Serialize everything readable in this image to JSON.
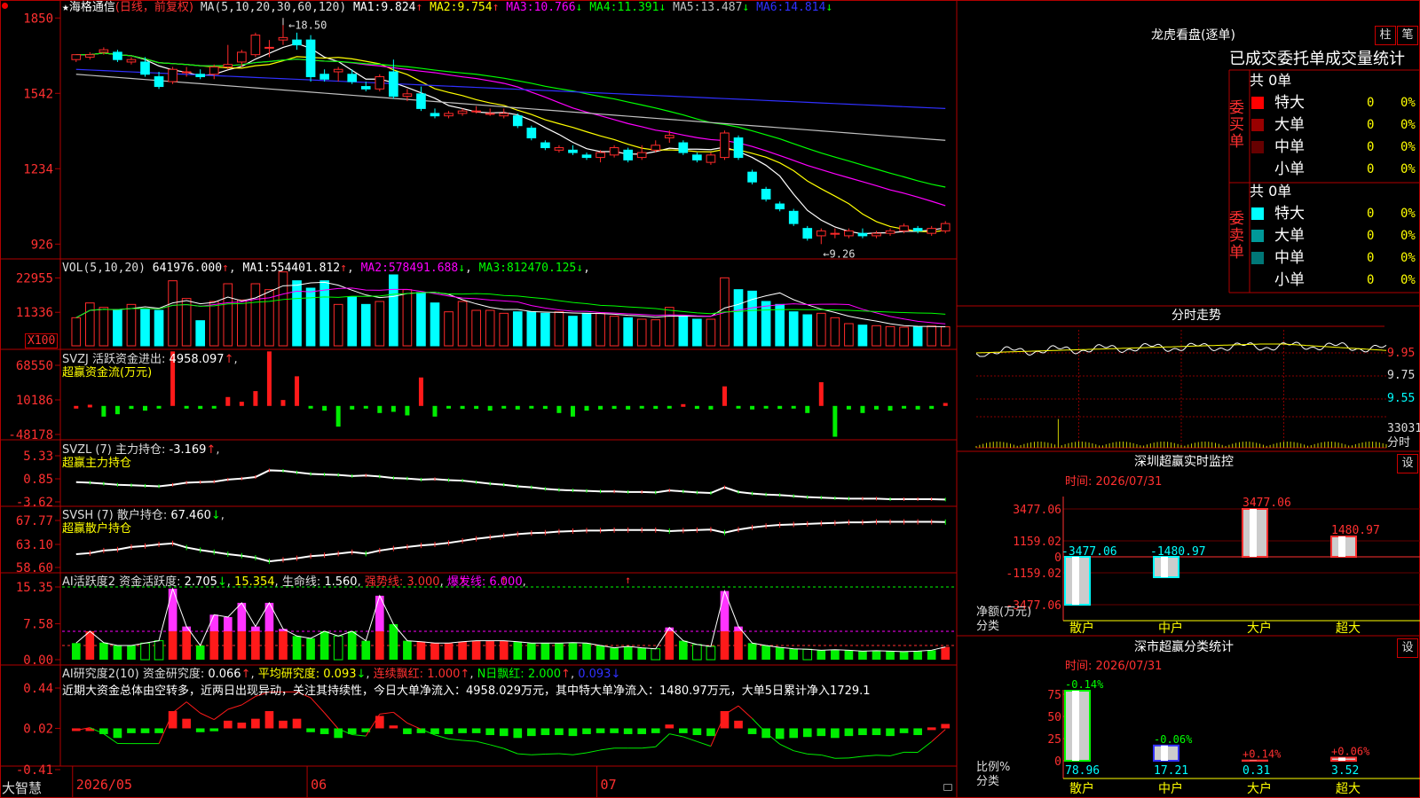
{
  "app": {
    "name": "大智慧",
    "logo_icon": "red-dot-icon"
  },
  "kline": {
    "name": "海格通信",
    "mode": "(日线，前复权)",
    "ma_params": "MA(5,10,20,30,60,120)",
    "ma": [
      {
        "label": "MA1:",
        "value": "9.824",
        "arrow": "↑",
        "color": "#ffffff"
      },
      {
        "label": "MA2:",
        "value": "9.754",
        "arrow": "↑",
        "color": "#ffff00"
      },
      {
        "label": "MA3:",
        "value": "10.766",
        "arrow": "↓",
        "color": "#ff00ff"
      },
      {
        "label": "MA4:",
        "value": "11.391",
        "arrow": "↓",
        "color": "#00ff00"
      },
      {
        "label": "MA5:",
        "value": "13.487",
        "arrow": "↓",
        "color": "#c0c0c0"
      },
      {
        "label": "MA6:",
        "value": "14.814",
        "arrow": "↓",
        "color": "#3030ff"
      }
    ],
    "y_ticks": [
      "1850",
      "1542",
      "1234",
      "926"
    ],
    "high_mark": "18.50",
    "low_mark": "9.26",
    "candles": [
      [
        16.8,
        17.0,
        16.7,
        17.0
      ],
      [
        16.9,
        17.1,
        16.8,
        17.0
      ],
      [
        17.1,
        17.3,
        17.0,
        17.2
      ],
      [
        17.1,
        17.2,
        16.7,
        16.8
      ],
      [
        16.7,
        16.9,
        16.6,
        16.8
      ],
      [
        16.7,
        16.9,
        16.1,
        16.2
      ],
      [
        16.1,
        16.3,
        15.6,
        15.7
      ],
      [
        15.9,
        16.5,
        15.8,
        16.4
      ],
      [
        16.3,
        16.5,
        16.1,
        16.3
      ],
      [
        16.2,
        16.4,
        16.0,
        16.1
      ],
      [
        16.2,
        16.6,
        16.0,
        16.5
      ],
      [
        16.5,
        17.4,
        16.4,
        16.6
      ],
      [
        16.7,
        17.2,
        16.5,
        17.1
      ],
      [
        17.0,
        17.9,
        16.9,
        17.8
      ],
      [
        17.3,
        17.6,
        16.9,
        17.3
      ],
      [
        17.6,
        18.5,
        17.4,
        17.7
      ],
      [
        17.6,
        17.9,
        17.2,
        17.4
      ],
      [
        17.6,
        17.8,
        15.9,
        16.1
      ],
      [
        16.2,
        16.4,
        15.9,
        16.0
      ],
      [
        16.3,
        16.5,
        15.9,
        16.4
      ],
      [
        16.2,
        16.4,
        15.8,
        15.9
      ],
      [
        15.7,
        15.9,
        15.5,
        15.6
      ],
      [
        15.6,
        16.2,
        15.5,
        16.1
      ],
      [
        16.3,
        16.8,
        15.2,
        15.3
      ],
      [
        15.3,
        15.6,
        15.1,
        15.4
      ],
      [
        15.4,
        15.7,
        14.7,
        14.8
      ],
      [
        14.6,
        14.8,
        14.4,
        14.5
      ],
      [
        14.5,
        14.7,
        14.4,
        14.6
      ],
      [
        14.6,
        14.8,
        14.5,
        14.7
      ],
      [
        14.7,
        14.9,
        14.6,
        14.7
      ],
      [
        14.6,
        14.8,
        14.5,
        14.6
      ],
      [
        14.5,
        14.8,
        14.4,
        14.6
      ],
      [
        14.5,
        14.6,
        14.0,
        14.1
      ],
      [
        14.0,
        14.1,
        13.5,
        13.6
      ],
      [
        13.4,
        13.5,
        13.1,
        13.2
      ],
      [
        13.1,
        13.3,
        13.0,
        13.2
      ],
      [
        13.1,
        13.3,
        12.9,
        13.0
      ],
      [
        12.9,
        13.0,
        12.7,
        12.8
      ],
      [
        12.8,
        13.1,
        12.6,
        13.0
      ],
      [
        12.9,
        13.3,
        12.8,
        13.2
      ],
      [
        13.1,
        13.2,
        12.6,
        12.7
      ],
      [
        12.8,
        13.3,
        12.7,
        13.0
      ],
      [
        13.1,
        13.5,
        13.0,
        13.3
      ],
      [
        13.6,
        13.9,
        13.4,
        13.7
      ],
      [
        13.4,
        13.5,
        12.9,
        13.0
      ],
      [
        12.9,
        13.0,
        12.6,
        12.7
      ],
      [
        12.6,
        13.0,
        12.5,
        12.9
      ],
      [
        12.8,
        13.9,
        12.7,
        13.8
      ],
      [
        13.6,
        13.7,
        12.7,
        12.8
      ],
      [
        12.2,
        12.3,
        11.7,
        11.8
      ],
      [
        11.5,
        11.6,
        11.0,
        11.1
      ],
      [
        10.9,
        11.0,
        10.6,
        10.7
      ],
      [
        10.6,
        10.7,
        10.0,
        10.1
      ],
      [
        9.9,
        10.0,
        9.4,
        9.5
      ],
      [
        9.6,
        9.9,
        9.26,
        9.8
      ],
      [
        9.7,
        9.9,
        9.5,
        9.7
      ],
      [
        9.6,
        9.9,
        9.5,
        9.8
      ],
      [
        9.7,
        9.9,
        9.5,
        9.6
      ],
      [
        9.6,
        9.8,
        9.5,
        9.7
      ],
      [
        9.7,
        9.9,
        9.6,
        9.8
      ],
      [
        9.8,
        10.1,
        9.7,
        10.0
      ],
      [
        9.9,
        10.0,
        9.7,
        9.8
      ],
      [
        9.7,
        10.0,
        9.6,
        9.9
      ],
      [
        9.8,
        10.2,
        9.7,
        10.1
      ]
    ]
  },
  "vol": {
    "params": "VOL(5,10,20)",
    "value": "641976.000",
    "arrow": "↑",
    "ma": [
      {
        "label": "MA1:",
        "value": "554401.812",
        "arrow": "↑",
        "color": "#ffffff"
      },
      {
        "label": "MA2:",
        "value": "578491.688",
        "arrow": "↓",
        "color": "#ff00ff"
      },
      {
        "label": "MA3:",
        "value": "812470.125",
        "arrow": "↓",
        "color": "#00ff00"
      }
    ],
    "y_ticks": [
      "22955",
      "11336"
    ],
    "unit": "X100",
    "bars": [
      9500,
      14500,
      13000,
      12000,
      14000,
      12500,
      12000,
      22000,
      16000,
      8500,
      15000,
      21000,
      15500,
      21000,
      19000,
      25000,
      22000,
      19500,
      22000,
      14000,
      16500,
      14000,
      15000,
      24000,
      19000,
      18000,
      14500,
      11500,
      15000,
      12000,
      12000,
      11000,
      11500,
      11500,
      11000,
      11500,
      10000,
      11000,
      11000,
      10000,
      9500,
      9000,
      8800,
      13000,
      10000,
      9000,
      9000,
      23000,
      19000,
      18500,
      15000,
      14000,
      11500,
      10500,
      11000,
      9500,
      7500,
      7000,
      6800,
      6500,
      6300,
      6400,
      6700,
      6420
    ]
  },
  "svzj": {
    "title": "SVZJ  活跃资金进出:",
    "value": "4958.097",
    "arrow": "↑",
    "subtitle": "超赢资金流(万元)",
    "y_ticks": [
      "68550",
      "10186",
      "-48178"
    ],
    "values": [
      0,
      2000,
      -18000,
      -14000,
      -5000,
      -8000,
      -4000,
      92000,
      -3000,
      -5000,
      -2000,
      15000,
      7000,
      25000,
      92000,
      10000,
      50000,
      -4000,
      -8000,
      -35000,
      -6000,
      -2000,
      -12000,
      -10000,
      -16000,
      48000,
      -18000,
      -3000,
      -5000,
      -5000,
      -8000,
      -3000,
      -6000,
      -4000,
      -5000,
      -12000,
      -18000,
      -8000,
      -6000,
      -5000,
      -6000,
      -3000,
      -5000,
      -4000,
      3000,
      -5000,
      -6000,
      33000,
      -3000,
      -6000,
      -4000,
      -5000,
      -3000,
      -12000,
      40000,
      -52000,
      -6000,
      -12000,
      -6000,
      -8000,
      -4000,
      -6000,
      -5000,
      4958
    ]
  },
  "svzl": {
    "title": "SVZL (7) 主力持仓:",
    "value": "-3.169",
    "arrow": "↑",
    "subtitle": "超赢主力持仓",
    "y_ticks": [
      "5.33",
      "0.85",
      "-3.62"
    ],
    "values": [
      0.2,
      0.1,
      -0.1,
      -0.3,
      -0.4,
      -0.5,
      -0.6,
      -0.3,
      0.1,
      0.2,
      0.3,
      0.7,
      0.9,
      1.2,
      2.5,
      2.4,
      2.1,
      1.8,
      1.7,
      1.6,
      1.4,
      1.5,
      1.3,
      1.0,
      0.9,
      0.7,
      0.8,
      0.6,
      0.5,
      0.2,
      -0.1,
      -0.3,
      -0.6,
      -0.8,
      -1.1,
      -1.3,
      -1.4,
      -1.5,
      -1.6,
      -1.6,
      -1.7,
      -1.7,
      -1.8,
      -1.4,
      -1.6,
      -1.8,
      -1.9,
      -0.8,
      -1.7,
      -2.0,
      -2.2,
      -2.3,
      -2.5,
      -2.7,
      -2.8,
      -2.9,
      -3.0,
      -3.0,
      -3.0,
      -3.1,
      -3.1,
      -3.1,
      -3.1,
      -3.169
    ]
  },
  "svsh": {
    "title": "SVSH (7) 散户持仓:",
    "value": "67.460",
    "arrow": "↓",
    "subtitle": "超赢散户持仓",
    "y_ticks": [
      "67.77",
      "63.10",
      "58.60"
    ],
    "values": [
      61.2,
      61.4,
      61.9,
      62.1,
      62.6,
      62.8,
      63.1,
      63.3,
      62.5,
      62.0,
      61.6,
      61.2,
      60.9,
      60.5,
      59.8,
      60.1,
      60.4,
      60.8,
      61.0,
      61.3,
      61.6,
      61.3,
      61.9,
      62.3,
      62.6,
      62.9,
      63.1,
      63.4,
      63.8,
      64.2,
      64.5,
      64.8,
      65.1,
      65.3,
      65.4,
      65.6,
      65.7,
      65.8,
      65.8,
      65.9,
      65.9,
      65.9,
      65.9,
      65.7,
      65.8,
      65.9,
      66.0,
      65.4,
      66.0,
      66.4,
      66.7,
      66.9,
      67.0,
      67.1,
      67.2,
      67.3,
      67.4,
      67.4,
      67.5,
      67.5,
      67.5,
      67.5,
      67.5,
      67.46
    ]
  },
  "ai_active": {
    "title": "AI活跃度2 资金活跃度:",
    "value1": "2.705",
    "arrow1": "↓",
    "value2": "15.354",
    "label_life": "生命线:",
    "value3": "1.560",
    "label_strong": "强势线:",
    "strong": "3.000",
    "label_burst": "爆发线:",
    "burst": "6.000",
    "y_ticks": [
      "15.35",
      "7.58",
      "0.00"
    ],
    "values": [
      3.5,
      6.0,
      3.6,
      3.0,
      3.0,
      3.5,
      4.0,
      15.0,
      7.0,
      3.0,
      9.5,
      9.0,
      12.0,
      7.0,
      12.0,
      6.5,
      5.0,
      4.5,
      6.0,
      5.0,
      6.0,
      4.0,
      13.5,
      7.5,
      4.0,
      3.8,
      3.5,
      3.5,
      3.8,
      4.0,
      4.0,
      4.0,
      3.8,
      3.5,
      3.5,
      3.5,
      3.6,
      3.5,
      3.0,
      2.5,
      2.8,
      2.5,
      2.3,
      6.8,
      4.0,
      3.2,
      2.8,
      14.5,
      7.0,
      3.5,
      3.0,
      2.6,
      2.3,
      2.2,
      2.0,
      2.1,
      2.0,
      1.8,
      1.9,
      1.8,
      1.7,
      1.8,
      2.0,
      2.7
    ],
    "red_idx": [
      1,
      7,
      8,
      10,
      11,
      12,
      13,
      14,
      15,
      22,
      25,
      26,
      27,
      28,
      29,
      30,
      31,
      43,
      47,
      48,
      63
    ]
  },
  "ai_research": {
    "title": "AI研究度2(10) 资金研究度:",
    "value1": "0.066",
    "arrow1": "↑",
    "label_avg": "平均研究度:",
    "avg": "0.093",
    "arrow2": "↓",
    "label_cont": "连续飘红:",
    "cont": "1.000",
    "arrow3": "↑",
    "label_n": "N日飘红:",
    "n": "2.000",
    "arrow4": "↑",
    "last": "0.093",
    "arrow5": "↓",
    "y_ticks": [
      "0.44",
      "0.02",
      "-0.41"
    ],
    "summary": "近期大资金总体由空转多，近两日出现异动，关注其持续性，今日大单净流入：4958.029万元，其中特大单净流入：1480.97万元，大单5日累计净入1729.1",
    "values": [
      0.0,
      0.02,
      -0.04,
      -0.08,
      -0.03,
      -0.03,
      -0.03,
      0.2,
      0.12,
      -0.02,
      -0.01,
      0.1,
      0.08,
      0.12,
      0.2,
      0.1,
      0.12,
      -0.02,
      -0.04,
      -0.08,
      -0.04,
      -0.02,
      0.15,
      0.05,
      -0.04,
      -0.03,
      -0.04,
      -0.04,
      -0.03,
      -0.03,
      -0.05,
      -0.06,
      -0.08,
      -0.06,
      -0.05,
      -0.05,
      -0.06,
      -0.04,
      -0.03,
      -0.03,
      -0.04,
      -0.04,
      -0.03,
      0.06,
      -0.03,
      -0.05,
      -0.06,
      0.2,
      0.1,
      -0.04,
      -0.08,
      -0.09,
      -0.08,
      -0.07,
      -0.06,
      -0.08,
      -0.06,
      -0.05,
      -0.05,
      -0.06,
      -0.03,
      -0.05,
      0.03,
      0.066
    ]
  },
  "x_axis": {
    "labels": [
      "2026/05",
      "06",
      "07"
    ],
    "label_idx": [
      0,
      17,
      38
    ]
  },
  "dragon_tiger": {
    "title": "龙虎看盘(逐单)",
    "btn_bar": "柱",
    "btn_pen": "笔",
    "header": "已成交委托单成交量统计",
    "buy_label": "委买单",
    "buy_total": "共 0单",
    "sell_label": "委卖单",
    "sell_total": "共 0单",
    "buy_rows": [
      {
        "name": "特大",
        "count": "0",
        "pct": "0%",
        "color": "#ff0000"
      },
      {
        "name": "大单",
        "count": "0",
        "pct": "0%",
        "color": "#990000"
      },
      {
        "name": "中单",
        "count": "0",
        "pct": "0%",
        "color": "#660000"
      },
      {
        "name": "小单",
        "count": "0",
        "pct": "0%",
        "color": ""
      }
    ],
    "sell_rows": [
      {
        "name": "特大",
        "count": "0",
        "pct": "0%",
        "color": "#00ffff"
      },
      {
        "name": "大单",
        "count": "0",
        "pct": "0%",
        "color": "#009999"
      },
      {
        "name": "中单",
        "count": "0",
        "pct": "0%",
        "color": "#007777"
      },
      {
        "name": "小单",
        "count": "0",
        "pct": "0%",
        "color": ""
      }
    ]
  },
  "intraday": {
    "title": "分时走势",
    "prices": [
      "9.95",
      "9.75",
      "9.55"
    ],
    "vol_label": "33031",
    "unit": "分时"
  },
  "monitor": {
    "title": "深圳超赢实时监控",
    "settings": "设",
    "time": "时间: 2026/07/31",
    "y_ticks": [
      "3477.06",
      "1159.02",
      "0",
      "-1159.02",
      "-3477.06"
    ],
    "y_label": "净额(万元)",
    "x_label": "分类",
    "categories": [
      "散户",
      "中户",
      "大户",
      "超大"
    ],
    "values": [
      -3477.06,
      -1480.97,
      3477.06,
      1480.97
    ],
    "value_labels": [
      "-3477.06",
      "-1480.97",
      "3477.06",
      "1480.97"
    ]
  },
  "classify": {
    "title": "深市超赢分类统计",
    "settings": "设",
    "time": "时间: 2026/07/31",
    "y_ticks": [
      "75",
      "50",
      "25",
      "0"
    ],
    "y_label": "比例%",
    "x_label": "分类",
    "categories": [
      "散户",
      "中户",
      "大户",
      "超大"
    ],
    "values": [
      78.96,
      17.21,
      0.31,
      3.52
    ],
    "value_labels": [
      "78.96",
      "17.21",
      "0.31",
      "3.52"
    ],
    "change_labels": [
      "-0.14%",
      "-0.06%",
      "+0.14%",
      "+0.06%"
    ]
  },
  "colors": {
    "up": "#ff2a2a",
    "down": "#00ffff",
    "frame": "#b00000",
    "axis_text": "#ff3030",
    "green": "#00ff00"
  }
}
